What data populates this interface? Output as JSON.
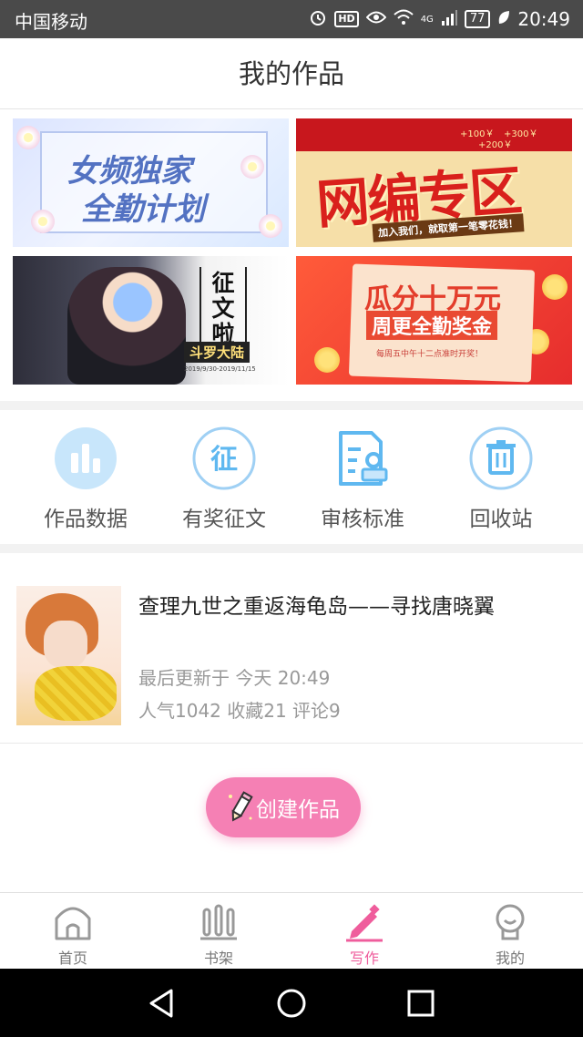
{
  "status_bar": {
    "carrier": "中国移动",
    "hd_badge": "HD",
    "network": "4G",
    "battery": "77",
    "time": "20:49"
  },
  "header": {
    "title": "我的作品"
  },
  "banners": [
    {
      "line1": "女频独家",
      "line2": "全勤计划"
    },
    {
      "title": "网编专区",
      "subtitle": "加入我们，就取第一笔零花钱！",
      "amounts": [
        "+100￥",
        "+300￥",
        "+200￥"
      ]
    },
    {
      "title": "征文啦",
      "tag": "斗罗大陆",
      "note": "2019/9/30-2019/11/15"
    },
    {
      "line1": "瓜分十万元",
      "line2": "周更全勤奖金",
      "note": "每周五中午十二点准时开奖！"
    }
  ],
  "quick_actions": [
    {
      "label": "作品数据",
      "icon": "bar-chart-icon"
    },
    {
      "label": "有奖征文",
      "icon": "zheng-badge-icon",
      "glyph": "征"
    },
    {
      "label": "审核标准",
      "icon": "document-stamp-icon"
    },
    {
      "label": "回收站",
      "icon": "trash-icon"
    }
  ],
  "work": {
    "title": "查理九世之重返海龟岛——寻找唐晓翼",
    "updated": "最后更新于 今天 20:49",
    "stats": "人气1042 收藏21 评论9"
  },
  "create_button": {
    "label": "创建作品"
  },
  "tabs": [
    {
      "label": "首页",
      "icon": "home-icon",
      "active": false
    },
    {
      "label": "书架",
      "icon": "bookshelf-icon",
      "active": false
    },
    {
      "label": "写作",
      "icon": "pen-icon",
      "active": true
    },
    {
      "label": "我的",
      "icon": "profile-icon",
      "active": false
    }
  ],
  "colors": {
    "accent_pink": "#ef5d9c",
    "create_button": "#f580b4",
    "icon_blue": "#5fb8f0",
    "icon_blue_fill": "#c8e6fb"
  }
}
